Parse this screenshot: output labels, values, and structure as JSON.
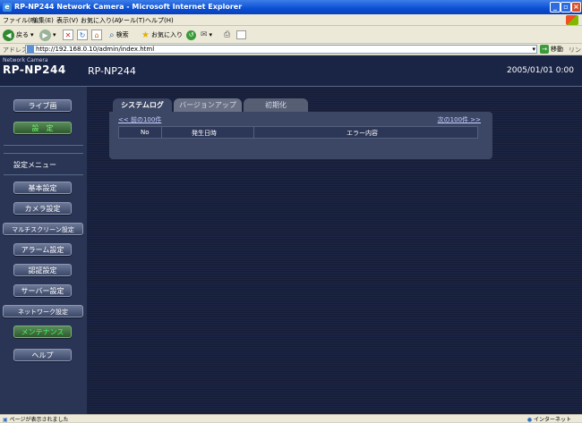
{
  "window": {
    "title": "RP-NP244 Network Camera - Microsoft Internet Explorer"
  },
  "menu": [
    "ファイル(F)",
    "編集(E)",
    "表示(V)",
    "お気に入り(A)",
    "ツール(T)",
    "ヘルプ(H)"
  ],
  "toolbar": {
    "back": "戻る",
    "search": "検索",
    "favorites": "お気に入り"
  },
  "address": {
    "label": "アドレス(D)",
    "url": "http://192.168.0.10/admin/index.html",
    "go": "移動",
    "links": "リンク"
  },
  "header": {
    "subtitle": "Network Camera",
    "model": "RP-NP244",
    "camera_name": "RP-NP244",
    "datetime": "2005/01/01  0:00"
  },
  "sidebar": {
    "live": "ライブ画",
    "settings": "設　定",
    "menu_title": "設定メニュー",
    "items": [
      "基本設定",
      "カメラ設定",
      "マルチスクリーン設定",
      "アラーム設定",
      "認証設定",
      "サーバー設定",
      "ネットワーク設定",
      "メンテナンス",
      "ヘルプ"
    ]
  },
  "tabs": [
    "システムログ",
    "バージョンアップ",
    "初期化"
  ],
  "log": {
    "prev": "<< 前の100件",
    "next": "次の100件 >>",
    "columns": [
      "No",
      "発生日時",
      "エラー内容"
    ]
  },
  "status": {
    "left": "ページが表示されました",
    "right": "インターネット"
  },
  "colors": {
    "page_bg": "#1a2340",
    "panel": "#3c4766",
    "active_green": "#3cff5a",
    "title_blue": "#0a4fd3"
  }
}
